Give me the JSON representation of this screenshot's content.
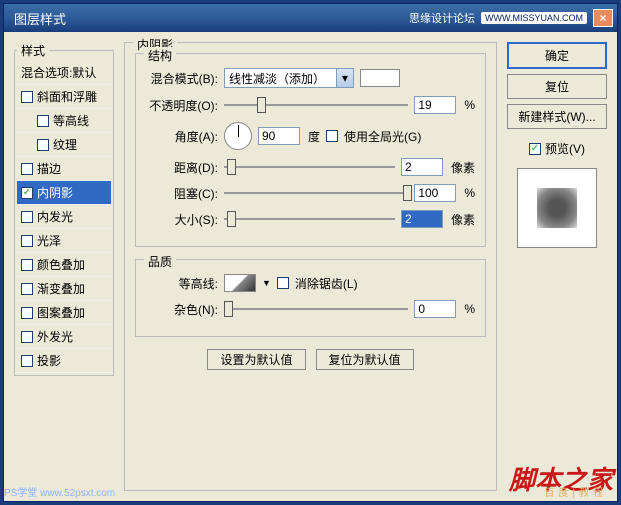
{
  "titlebar": {
    "title": "图层样式",
    "promo": "思缘设计论坛",
    "url": "WWW.MISSYUAN.COM",
    "close": "×"
  },
  "styles": {
    "legend": "样式",
    "items": [
      {
        "label": "混合选项:默认",
        "checked": null,
        "indent": false
      },
      {
        "label": "斜面和浮雕",
        "checked": false,
        "indent": false
      },
      {
        "label": "等高线",
        "checked": false,
        "indent": true
      },
      {
        "label": "纹理",
        "checked": false,
        "indent": true
      },
      {
        "label": "描边",
        "checked": false,
        "indent": false
      },
      {
        "label": "内阴影",
        "checked": true,
        "indent": false,
        "selected": true
      },
      {
        "label": "内发光",
        "checked": false,
        "indent": false
      },
      {
        "label": "光泽",
        "checked": false,
        "indent": false
      },
      {
        "label": "颜色叠加",
        "checked": false,
        "indent": false
      },
      {
        "label": "渐变叠加",
        "checked": false,
        "indent": false
      },
      {
        "label": "图案叠加",
        "checked": false,
        "indent": false
      },
      {
        "label": "外发光",
        "checked": false,
        "indent": false
      },
      {
        "label": "投影",
        "checked": false,
        "indent": false
      }
    ]
  },
  "mid": {
    "legend": "内阴影"
  },
  "structure": {
    "legend": "结构",
    "blend_mode": {
      "label": "混合模式(B):",
      "value": "线性减淡（添加）",
      "color": "#ffffff"
    },
    "opacity": {
      "label": "不透明度(O):",
      "value": "19",
      "unit": "%",
      "thumb": 18
    },
    "angle": {
      "label": "角度(A):",
      "value": "90",
      "unit": "度"
    },
    "global_light": {
      "label": "使用全局光(G)",
      "checked": false
    },
    "distance": {
      "label": "距离(D):",
      "value": "2",
      "unit": "像素",
      "thumb": 2
    },
    "choke": {
      "label": "阻塞(C):",
      "value": "100",
      "unit": "%",
      "thumb": 98
    },
    "size": {
      "label": "大小(S):",
      "value": "2",
      "unit": "像素",
      "thumb": 2,
      "selected": true
    }
  },
  "quality": {
    "legend": "品质",
    "contour": {
      "label": "等高线:"
    },
    "antialias": {
      "label": "消除锯齿(L)",
      "checked": false
    },
    "noise": {
      "label": "杂色(N):",
      "value": "0",
      "unit": "%",
      "thumb": 0
    }
  },
  "buttons": {
    "set_default": "设置为默认值",
    "reset_default": "复位为默认值"
  },
  "right": {
    "ok": "确定",
    "cancel": "复位",
    "new_style": "新建样式(W)...",
    "preview": "预览(V)",
    "preview_checked": true
  },
  "watermarks": {
    "w1": "PS学堂  www.52psxt.com",
    "w2": "脚本之家",
    "w3": "百度|教程"
  }
}
